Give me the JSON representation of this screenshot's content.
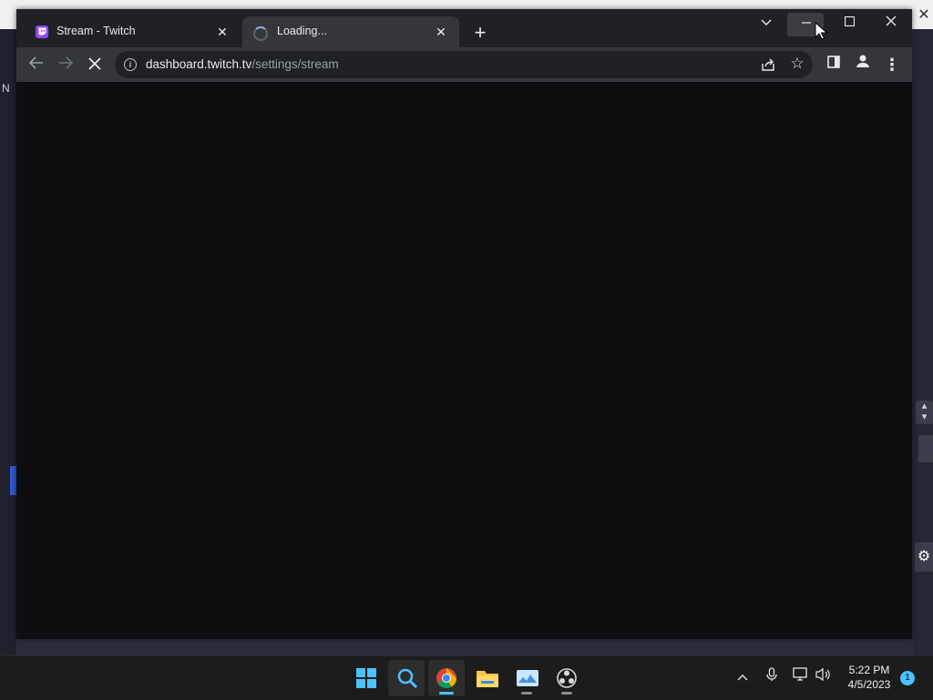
{
  "background_app": {
    "left_text": "N",
    "close_glyph": "✕"
  },
  "browser": {
    "tabs": [
      {
        "title": "Stream - Twitch",
        "favicon": "twitch-icon",
        "active": false
      },
      {
        "title": "Loading...",
        "favicon": "spinner-icon",
        "active": true
      }
    ],
    "address_bar": {
      "url_host": "dashboard.twitch.tv",
      "url_path": "/settings/stream"
    },
    "page_state": "loading"
  },
  "taskbar": {
    "apps": [
      "windows-start",
      "search",
      "chrome",
      "file-explorer",
      "photos",
      "obs-studio"
    ],
    "clock": {
      "time": "5:22 PM",
      "date": "4/5/2023"
    },
    "notification_count": "1"
  },
  "colors": {
    "tab_strip": "#202124",
    "toolbar": "#35363a",
    "content_bg": "#0e0e10",
    "twitch_purple": "#9146ff",
    "taskbar": "#1c1c1c"
  }
}
